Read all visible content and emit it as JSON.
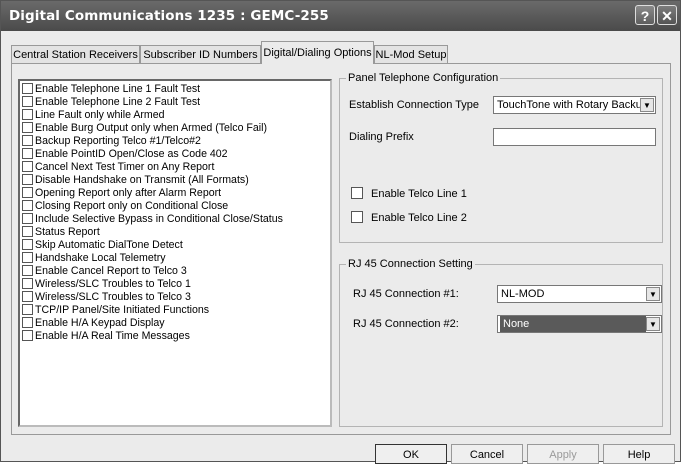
{
  "window": {
    "title": "Digital Communications 1235 : GEMC-255",
    "help_glyph": "?",
    "close_glyph": "✕"
  },
  "tabs": [
    {
      "label": "Central Station Receivers"
    },
    {
      "label": "Subscriber ID Numbers"
    },
    {
      "label": "Digital/Dialing Options"
    },
    {
      "label": "NL-Mod Setup"
    }
  ],
  "options_list": [
    {
      "label": "Enable Telephone Line 1 Fault Test"
    },
    {
      "label": "Enable Telephone Line 2 Fault Test"
    },
    {
      "label": "Line Fault only while Armed"
    },
    {
      "label": "Enable Burg Output only when Armed (Telco Fail)"
    },
    {
      "label": "Backup Reporting Telco #1/Telco#2"
    },
    {
      "label": "Enable PointID Open/Close as Code 402"
    },
    {
      "label": "Cancel Next Test Timer on Any Report"
    },
    {
      "label": "Disable Handshake on Transmit (All Formats)"
    },
    {
      "label": "Opening Report only after Alarm Report"
    },
    {
      "label": "Closing Report only on Conditional Close"
    },
    {
      "label": "Include Selective Bypass in Conditional Close/Status"
    },
    {
      "label": "Status Report"
    },
    {
      "label": "Skip Automatic DialTone Detect"
    },
    {
      "label": "Handshake Local Telemetry"
    },
    {
      "label": "Enable Cancel Report to Telco 3"
    },
    {
      "label": "Wireless/SLC Troubles to Telco 1"
    },
    {
      "label": "Wireless/SLC Troubles to Telco 3"
    },
    {
      "label": "TCP/IP Panel/Site Initiated Functions"
    },
    {
      "label": "Enable H/A Keypad Display"
    },
    {
      "label": "Enable H/A Real Time Messages"
    }
  ],
  "panel_telephone": {
    "title": "Panel Telephone Configuration",
    "connection_type_label": "Establish Connection Type",
    "connection_type_value": "TouchTone with Rotary Backu",
    "dialing_prefix_label": "Dialing Prefix",
    "dialing_prefix_value": "",
    "telco1_label": "Enable Telco Line 1",
    "telco2_label": "Enable Telco Line 2"
  },
  "rj45": {
    "title": "RJ 45 Connection Setting",
    "conn1_label": "RJ 45 Connection #1:",
    "conn1_value": "NL-MOD",
    "conn2_label": "RJ 45 Connection #2:",
    "conn2_value": "None"
  },
  "footer": {
    "ok": "OK",
    "cancel": "Cancel",
    "apply": "Apply",
    "help": "Help"
  },
  "icons": {
    "dropdown_arrow": "▼"
  }
}
